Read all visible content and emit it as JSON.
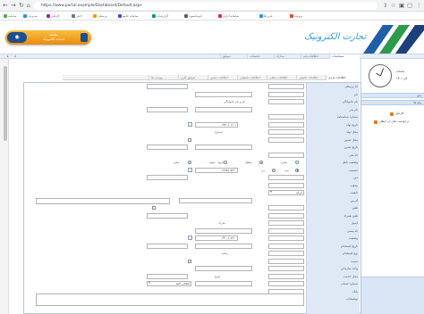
{
  "browser": {
    "url": "https://www.portal.example/Dashboard/Default.aspx",
    "bookmarks": [
      "سامانه",
      "مدیریت",
      "کارتابل",
      "اخبار",
      "پرسنلی",
      "سامانه جامع",
      "گزارشات",
      "اتوماسیون",
      "سامانه اداری",
      "فرم ها",
      "پرونده"
    ]
  },
  "promo": {
    "line1": "سامانه",
    "line2": "خدمات الکترونیک"
  },
  "logo": {
    "text": "تجارت الکترونیک"
  },
  "tabs": [
    "مشخصات",
    "اطلاعات پایه",
    "مدارک",
    "تحصیلات",
    "سوابق"
  ],
  "subtabs": [
    "اطلاعات فردی",
    "اطلاعات تکمیلی",
    "اطلاعات شغلی",
    "اطلاعات تحصیلی",
    "اطلاعات تماس",
    "سوابق کاری",
    "پیوست ها"
  ],
  "right_panel": {
    "title": "سامانه",
    "date": "۱۴۰۱ آذر",
    "bar1": "منو",
    "bar2": "پیام ها",
    "item1": "کارتابل",
    "item2": "درخواست های در انتظار"
  },
  "form": {
    "labels": [
      "کد پرسنلی",
      "نام",
      "نام خانوادگی",
      "نام پدر",
      "شماره شناسنامه",
      "تاریخ تولد",
      "محل تولد",
      "محل صدور",
      "تاریخ صدور",
      "کد ملی",
      "وضعیت تاهل",
      "جنسیت",
      "دین",
      "مذهب",
      "تابعیت",
      "آدرس",
      "تلفن",
      "تلفن همراه",
      "ایمیل",
      "کد پستی",
      "وضعیت",
      "تاریخ استخدام",
      "نوع استخدام",
      "سمت",
      "واحد سازمانی",
      "محل خدمت",
      "شماره حساب",
      "بانک",
      "توضیحات"
    ],
    "mid_labels": [
      "نام و نام خانوادگی",
      "شماره",
      "تاریخ",
      "مدرک",
      "رشته",
      "تاریخ",
      "محل",
      "شماره تماس",
      "نام بانک",
      "مبلغ"
    ],
    "gender_options": [
      "مرد",
      "زن"
    ],
    "status_options": [
      "مجرد",
      "متاهل",
      "معیل",
      "سایر"
    ],
    "values": {
      "date1": "۱۳۷۰/۰۱/۰۱",
      "date2": "۱۳۹۸/۰۵/۲۰",
      "date3": "۱۴۰۰/۰۲/۱۰",
      "select1": "ایران",
      "select2": "انتخاب کنید"
    }
  }
}
